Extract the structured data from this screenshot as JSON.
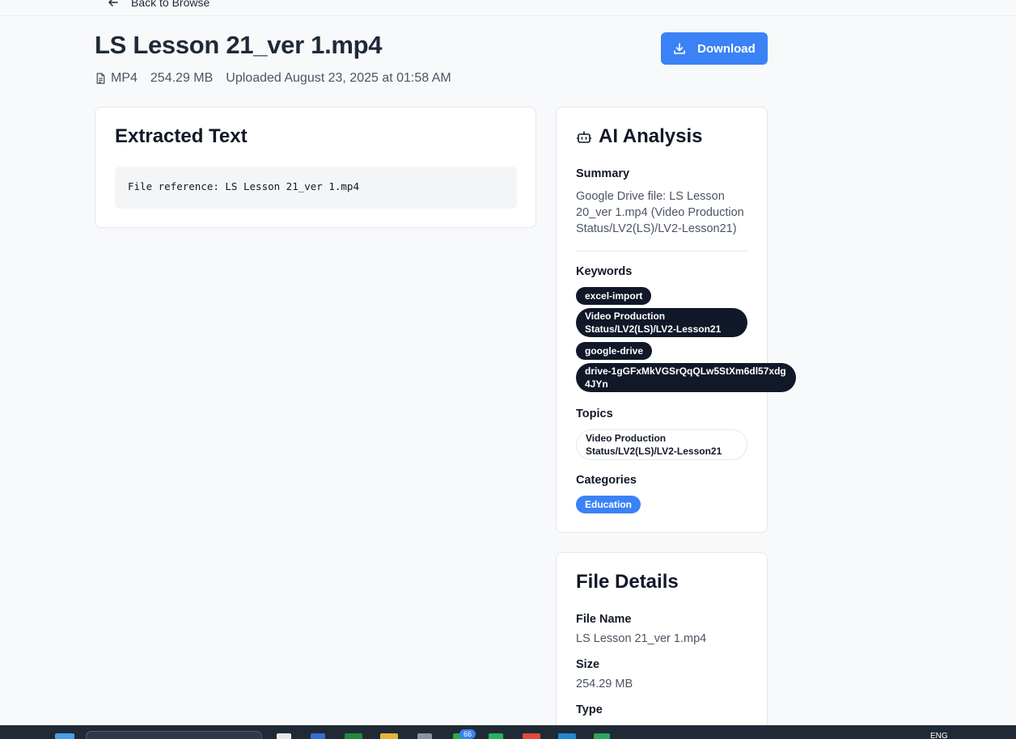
{
  "nav": {
    "back_label": "Back to Browse"
  },
  "file": {
    "title": "LS Lesson 21_ver 1.mp4",
    "format": "MP4",
    "size": "254.29 MB",
    "uploaded": "Uploaded August 23, 2025 at 01:58 AM"
  },
  "actions": {
    "download_label": "Download"
  },
  "extracted": {
    "title": "Extracted Text",
    "content": "File reference: LS Lesson 21_ver 1.mp4"
  },
  "ai": {
    "title": "AI Analysis",
    "summary_label": "Summary",
    "summary": "Google Drive file: LS Lesson 20_ver 1.mp4 (Video Production Status/LV2(LS)/LV2-Lesson21)",
    "keywords_label": "Keywords",
    "keywords": [
      "excel-import",
      "Video Production Status/LV2(LS)/LV2-Lesson21",
      "google-drive",
      "drive-1gGFxMkVGSrQqQLw5StXm6dl57xdg4JYn"
    ],
    "topics_label": "Topics",
    "topics": [
      "Video Production Status/LV2(LS)/LV2-Lesson21"
    ],
    "categories_label": "Categories",
    "categories": [
      "Education"
    ]
  },
  "details": {
    "title": "File Details",
    "file_name_label": "File Name",
    "file_name": "LS Lesson 21_ver 1.mp4",
    "size_label": "Size",
    "size": "254.29 MB",
    "type_label": "Type"
  },
  "taskbar": {
    "lang": "ENG",
    "badge": "66"
  },
  "colors": {
    "accent": "#3b82f6",
    "dark_pill": "#111827",
    "background": "#f8f9fb"
  }
}
